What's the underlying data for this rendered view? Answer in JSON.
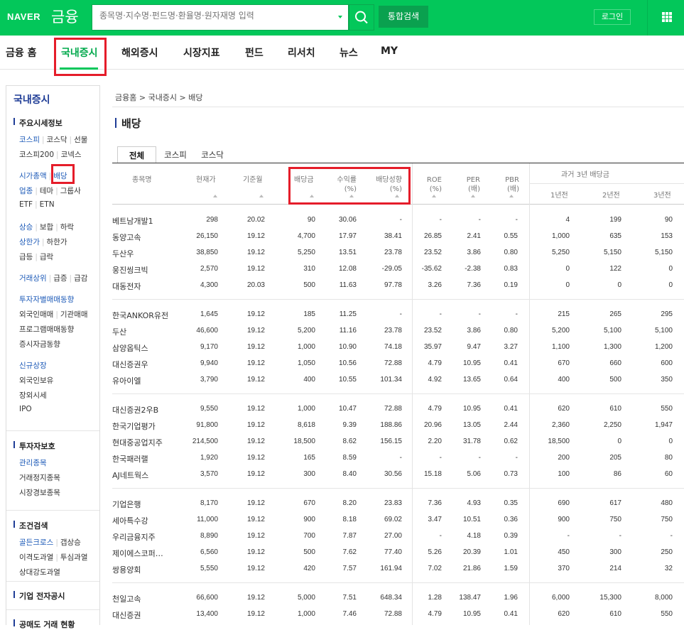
{
  "header": {
    "logo": "NAVER",
    "service": "금융",
    "search_placeholder": "종목명·지수명·펀드명·환율명·원자재명 입력",
    "total_search": "통합검색",
    "login": "로그인"
  },
  "gnb": [
    "금융 홈",
    "국내증시",
    "해외증시",
    "시장지표",
    "펀드",
    "리서치",
    "뉴스",
    "MY"
  ],
  "lnb": {
    "title": "국내증시",
    "sections": [
      {
        "title": "주요시세정보",
        "lines": [
          [
            {
              "t": "코스피",
              "blue": true
            },
            {
              "t": "코스닥"
            },
            {
              "t": "선물"
            }
          ],
          [
            {
              "t": "코스피200"
            },
            {
              "t": "코넥스"
            }
          ],
          [],
          [
            {
              "t": "시가총액",
              "blue": true
            },
            {
              "t": "배당",
              "blue": true
            }
          ],
          [
            {
              "t": "업종",
              "blue": true
            },
            {
              "t": "테마"
            },
            {
              "t": "그룹사"
            }
          ],
          [
            {
              "t": "ETF"
            },
            {
              "t": "ETN"
            }
          ],
          [],
          [
            {
              "t": "상승",
              "blue": true
            },
            {
              "t": "보합"
            },
            {
              "t": "하락"
            }
          ],
          [
            {
              "t": "상한가",
              "blue": true
            },
            {
              "t": "하한가"
            }
          ],
          [
            {
              "t": "급등"
            },
            {
              "t": "급락"
            }
          ],
          [],
          [
            {
              "t": "거래상위",
              "blue": true
            },
            {
              "t": "급증"
            },
            {
              "t": "급감"
            }
          ],
          [],
          [
            {
              "t": "투자자별매매동향",
              "blue": true
            }
          ],
          [
            {
              "t": "외국인매매"
            },
            {
              "t": "기관매매"
            }
          ],
          [
            {
              "t": "프로그램매매동향"
            }
          ],
          [
            {
              "t": "증시자금동향"
            }
          ],
          [],
          [
            {
              "t": "신규상장",
              "blue": true
            }
          ],
          [
            {
              "t": "외국인보유"
            }
          ],
          [
            {
              "t": "장외시세"
            }
          ],
          [
            {
              "t": "IPO"
            }
          ]
        ]
      },
      {
        "title": "투자자보호",
        "lines": [
          [
            {
              "t": "관리종목",
              "blue": true
            }
          ],
          [
            {
              "t": "거래정지종목"
            }
          ],
          [
            {
              "t": "시장경보종목"
            }
          ]
        ]
      },
      {
        "title": "조건검색",
        "lines": [
          [
            {
              "t": "골든크로스",
              "blue": true
            },
            {
              "t": "갭상승"
            }
          ],
          [
            {
              "t": "이격도과열"
            },
            {
              "t": "투심과열"
            }
          ],
          [
            {
              "t": "상대강도과열"
            }
          ]
        ]
      },
      {
        "title": "기업 전자공시",
        "lines": []
      },
      {
        "title": "공매도 거래 현황",
        "lines": []
      }
    ]
  },
  "breadcrumb": "금융홈 > 국내증시 > 배당",
  "page_title": "배당",
  "tabs": [
    "전체",
    "코스피",
    "코스닥"
  ],
  "columns": {
    "name": "종목명",
    "price": "현재가",
    "base_month": "기준월",
    "dividend": "배당금",
    "yield": [
      "수익률",
      "(%)"
    ],
    "payout": [
      "배당성향",
      "(%)"
    ],
    "roe": [
      "ROE",
      "(%)"
    ],
    "per": [
      "PER",
      "(배)"
    ],
    "pbr": [
      "PBR",
      "(배)"
    ],
    "past": "과거 3년 배당금",
    "y1": "1년전",
    "y2": "2년전",
    "y3": "3년전"
  },
  "groups": [
    [
      [
        "베트남개발1",
        "298",
        "20.02",
        "90",
        "30.06",
        "-",
        "-",
        "-",
        "-",
        "4",
        "199",
        "90"
      ],
      [
        "동양고속",
        "26,150",
        "19.12",
        "4,700",
        "17.97",
        "38.41",
        "26.85",
        "2.41",
        "0.55",
        "1,000",
        "635",
        "153"
      ],
      [
        "두산우",
        "38,850",
        "19.12",
        "5,250",
        "13.51",
        "23.78",
        "23.52",
        "3.86",
        "0.80",
        "5,250",
        "5,150",
        "5,150"
      ],
      [
        "웅진씽크빅",
        "2,570",
        "19.12",
        "310",
        "12.08",
        "-29.05",
        "-35.62",
        "-2.38",
        "0.83",
        "0",
        "122",
        "0"
      ],
      [
        "대동전자",
        "4,300",
        "20.03",
        "500",
        "11.63",
        "97.78",
        "3.26",
        "7.36",
        "0.19",
        "0",
        "0",
        "0"
      ]
    ],
    [
      [
        "한국ANKOR유전",
        "1,645",
        "19.12",
        "185",
        "11.25",
        "-",
        "-",
        "-",
        "-",
        "215",
        "265",
        "295"
      ],
      [
        "두산",
        "46,600",
        "19.12",
        "5,200",
        "11.16",
        "23.78",
        "23.52",
        "3.86",
        "0.80",
        "5,200",
        "5,100",
        "5,100"
      ],
      [
        "삼양옵틱스",
        "9,170",
        "19.12",
        "1,000",
        "10.90",
        "74.18",
        "35.97",
        "9.47",
        "3.27",
        "1,100",
        "1,300",
        "1,200"
      ],
      [
        "대신증권우",
        "9,940",
        "19.12",
        "1,050",
        "10.56",
        "72.88",
        "4.79",
        "10.95",
        "0.41",
        "670",
        "660",
        "600"
      ],
      [
        "유아이엘",
        "3,790",
        "19.12",
        "400",
        "10.55",
        "101.34",
        "4.92",
        "13.65",
        "0.64",
        "400",
        "500",
        "350"
      ]
    ],
    [
      [
        "대신증권2우B",
        "9,550",
        "19.12",
        "1,000",
        "10.47",
        "72.88",
        "4.79",
        "10.95",
        "0.41",
        "620",
        "610",
        "550"
      ],
      [
        "한국기업평가",
        "91,800",
        "19.12",
        "8,618",
        "9.39",
        "188.86",
        "20.96",
        "13.05",
        "2.44",
        "2,360",
        "2,250",
        "1,947"
      ],
      [
        "현대중공업지주",
        "214,500",
        "19.12",
        "18,500",
        "8.62",
        "156.15",
        "2.20",
        "31.78",
        "0.62",
        "18,500",
        "0",
        "0"
      ],
      [
        "한국패러랠",
        "1,920",
        "19.12",
        "165",
        "8.59",
        "-",
        "-",
        "-",
        "-",
        "200",
        "205",
        "80"
      ],
      [
        "AJ네트웍스",
        "3,570",
        "19.12",
        "300",
        "8.40",
        "30.56",
        "15.18",
        "5.06",
        "0.73",
        "100",
        "86",
        "60"
      ]
    ],
    [
      [
        "기업은행",
        "8,170",
        "19.12",
        "670",
        "8.20",
        "23.83",
        "7.36",
        "4.93",
        "0.35",
        "690",
        "617",
        "480"
      ],
      [
        "세아특수강",
        "11,000",
        "19.12",
        "900",
        "8.18",
        "69.02",
        "3.47",
        "10.51",
        "0.36",
        "900",
        "750",
        "750"
      ],
      [
        "우리금융지주",
        "8,890",
        "19.12",
        "700",
        "7.87",
        "27.00",
        "-",
        "4.18",
        "0.39",
        "-",
        "-",
        "-"
      ],
      [
        "제이에스코퍼…",
        "6,560",
        "19.12",
        "500",
        "7.62",
        "77.40",
        "5.26",
        "20.39",
        "1.01",
        "450",
        "300",
        "250"
      ],
      [
        "쌍용양회",
        "5,550",
        "19.12",
        "420",
        "7.57",
        "161.94",
        "7.02",
        "21.86",
        "1.59",
        "370",
        "214",
        "32"
      ]
    ],
    [
      [
        "천일고속",
        "66,600",
        "19.12",
        "5,000",
        "7.51",
        "648.34",
        "1.28",
        "138.47",
        "1.96",
        "6,000",
        "15,300",
        "8,000"
      ],
      [
        "대신증권",
        "13,400",
        "19.12",
        "1,000",
        "7.46",
        "72.88",
        "4.79",
        "10.95",
        "0.41",
        "620",
        "610",
        "550"
      ]
    ]
  ]
}
